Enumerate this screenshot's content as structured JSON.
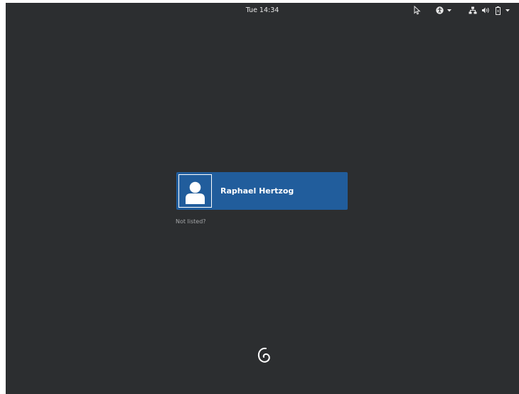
{
  "topbar": {
    "clock": "Tue 14:34",
    "icons": {
      "pointer": "cursor-icon",
      "accessibility": "accessibility-icon",
      "accessibility_menu": "chevron-down-icon",
      "network": "network-wired-icon",
      "volume": "volume-icon",
      "battery": "battery-icon",
      "system_menu": "chevron-down-icon"
    }
  },
  "login": {
    "user": {
      "name": "Raphael Hertzog",
      "avatar_icon": "user-avatar-icon"
    },
    "not_listed_label": "Not listed?"
  },
  "branding": {
    "logo_icon": "debian-swirl-icon"
  },
  "colors": {
    "background": "#2c2e30",
    "selection": "#215d9c",
    "text": "#ffffff",
    "muted_text": "#a4a6a8"
  }
}
